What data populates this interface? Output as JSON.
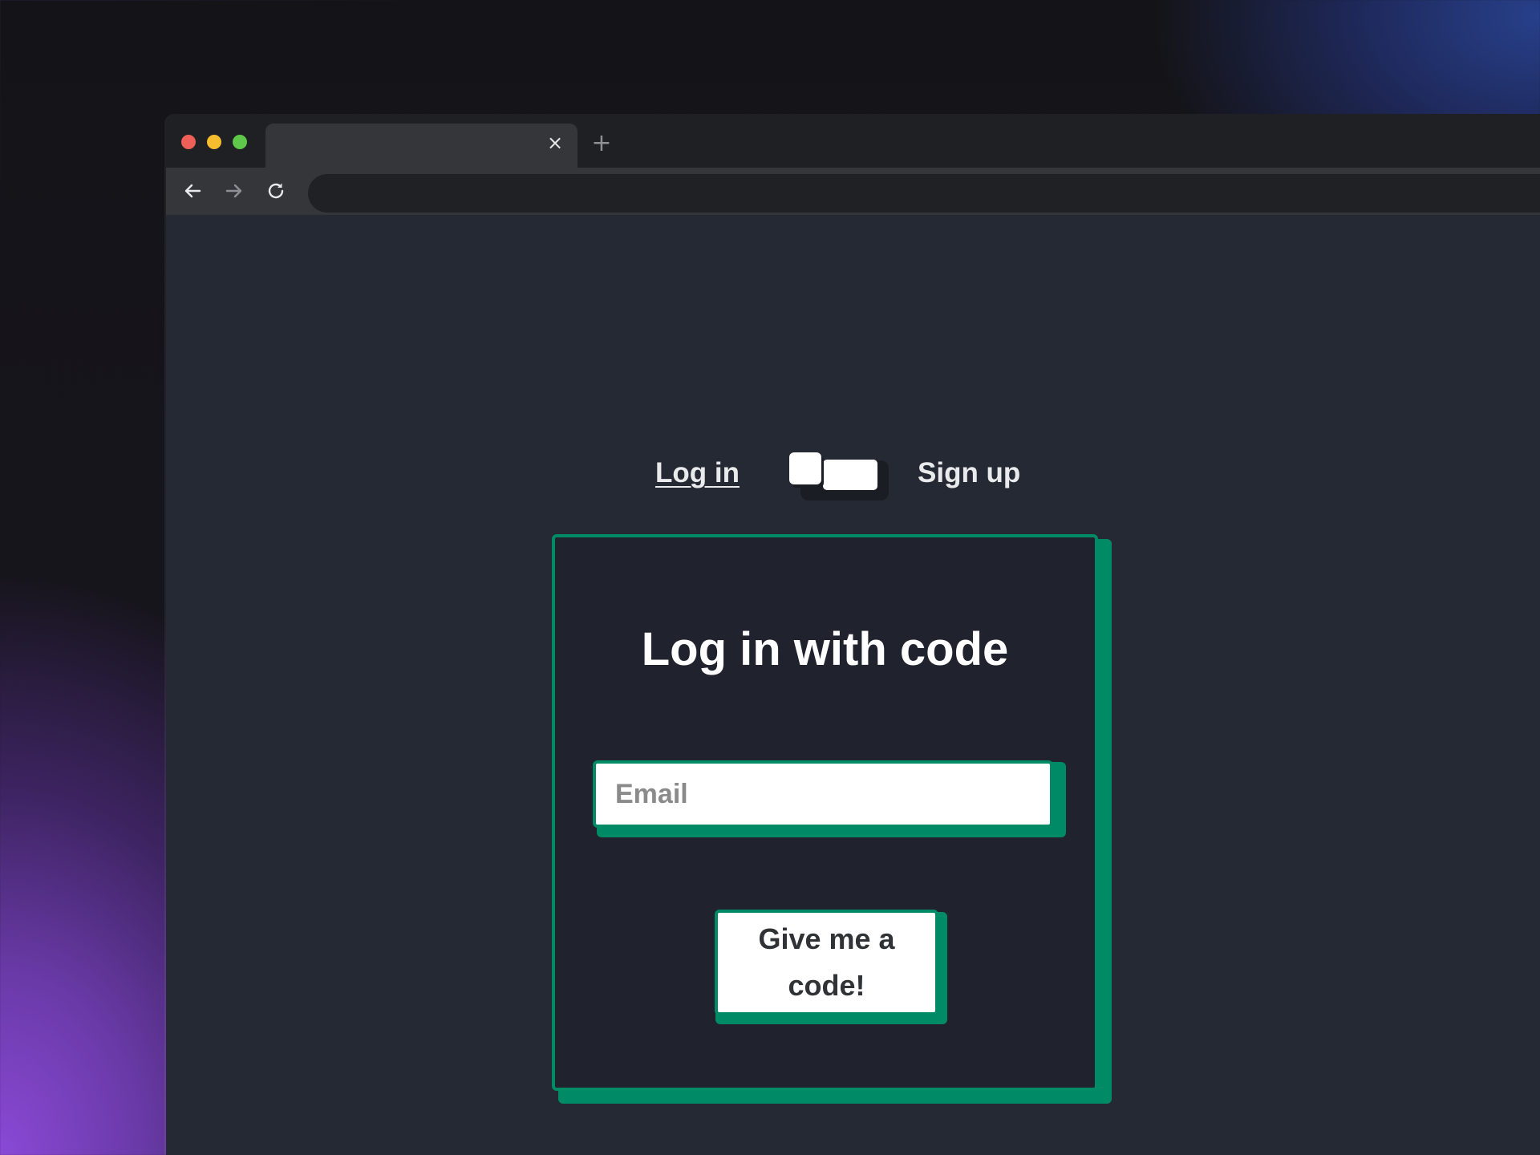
{
  "browser": {
    "tab": {
      "close_icon": "×"
    },
    "new_tab_icon": "+",
    "nav": {
      "back_icon": "arrow-left-icon",
      "forward_icon": "arrow-right-icon",
      "reload_icon": "reload-icon"
    },
    "address_bar": {
      "value": ""
    }
  },
  "auth_toggle": {
    "login_label": "Log in",
    "signup_label": "Sign up",
    "selected": "Log in"
  },
  "login_card": {
    "title": "Log in with code",
    "email": {
      "placeholder": "Email",
      "value": ""
    },
    "submit_label": "Give me a code!"
  },
  "colors": {
    "accent": "#008a66",
    "page_background": "#252934",
    "card_background": "#20232d",
    "text": "#ffffff"
  }
}
